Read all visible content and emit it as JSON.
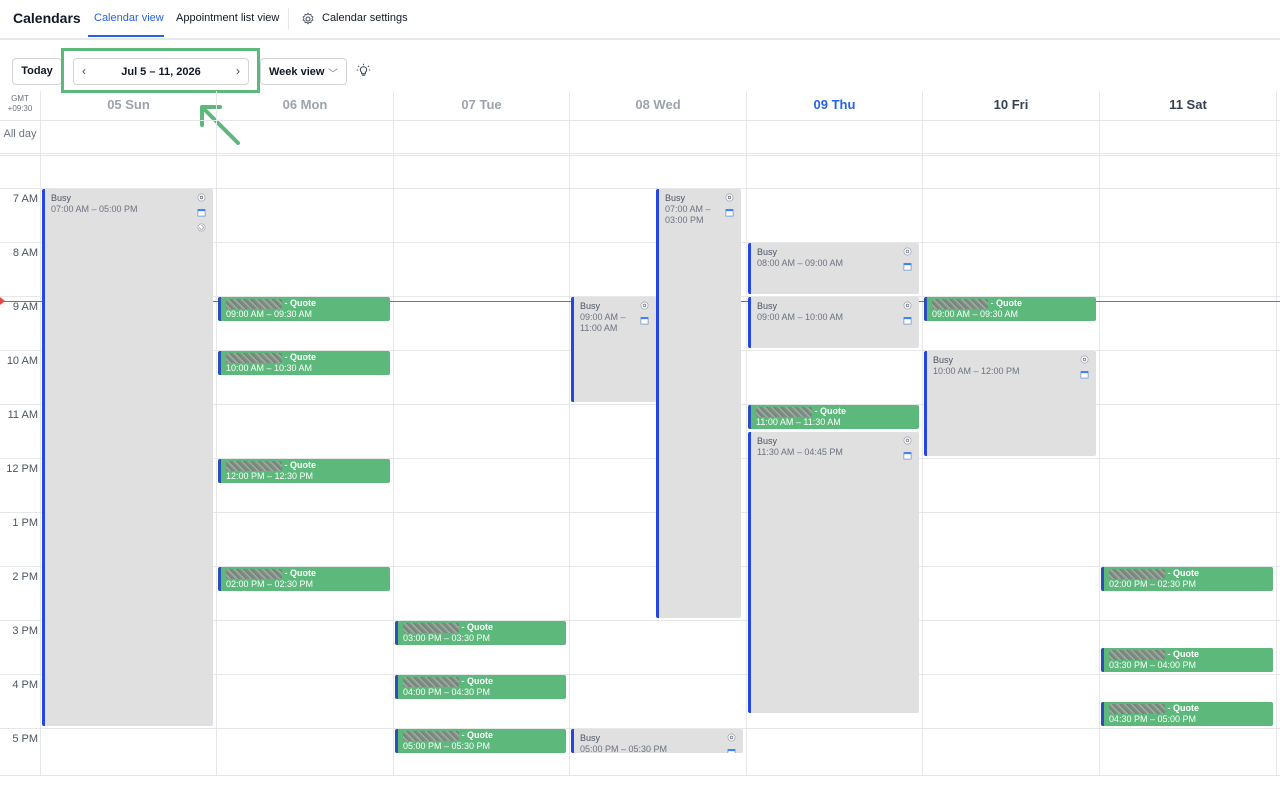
{
  "header": {
    "title": "Calendars",
    "tabs": [
      {
        "label": "Calendar view",
        "active": true
      },
      {
        "label": "Appointment list view",
        "active": false
      }
    ],
    "settings_label": "Calendar settings"
  },
  "toolbar": {
    "today_label": "Today",
    "date_range": "Jul 5 – 11, 2026",
    "view_select": "Week view"
  },
  "grid": {
    "timezone_line1": "GMT",
    "timezone_line2": "+09:30",
    "all_day_label": "All day",
    "days": [
      {
        "label": "05 Sun",
        "state": "past"
      },
      {
        "label": "06 Mon",
        "state": "past"
      },
      {
        "label": "07 Tue",
        "state": "past"
      },
      {
        "label": "08 Wed",
        "state": "past"
      },
      {
        "label": "09 Thu",
        "state": "today"
      },
      {
        "label": "10 Fri",
        "state": "future"
      },
      {
        "label": "11 Sat",
        "state": "future"
      }
    ],
    "hours": [
      "7 AM",
      "8 AM",
      "9 AM",
      "10 AM",
      "11 AM",
      "12 PM",
      "1 PM",
      "2 PM",
      "3 PM",
      "4 PM",
      "5 PM"
    ]
  },
  "events": [
    {
      "day": 0,
      "type": "busy",
      "title": "Busy",
      "time": "07:00 AM – 05:00 PM",
      "start": 7.0,
      "end": 17.0
    },
    {
      "day": 1,
      "type": "quote",
      "title": "- Quote",
      "time": "09:00 AM – 09:30 AM",
      "start": 9.0,
      "end": 9.5
    },
    {
      "day": 1,
      "type": "quote",
      "title": "- Quote",
      "time": "10:00 AM – 10:30 AM",
      "start": 10.0,
      "end": 10.5
    },
    {
      "day": 1,
      "type": "quote",
      "title": "- Quote",
      "time": "12:00 PM – 12:30 PM",
      "start": 12.0,
      "end": 12.5
    },
    {
      "day": 1,
      "type": "quote",
      "title": "- Quote",
      "time": "02:00 PM – 02:30 PM",
      "start": 14.0,
      "end": 14.5
    },
    {
      "day": 2,
      "type": "quote",
      "title": "- Quote",
      "time": "03:00 PM – 03:30 PM",
      "start": 15.0,
      "end": 15.5
    },
    {
      "day": 2,
      "type": "quote",
      "title": "- Quote",
      "time": "04:00 PM – 04:30 PM",
      "start": 16.0,
      "end": 16.5
    },
    {
      "day": 2,
      "type": "quote",
      "title": "- Quote",
      "time": "05:00 PM – 05:30 PM",
      "start": 17.0,
      "end": 17.5
    },
    {
      "day": 3,
      "type": "busy",
      "title": "Busy",
      "time": "09:00 AM – 11:00 AM",
      "start": 9.0,
      "end": 11.0,
      "slot": "left"
    },
    {
      "day": 3,
      "type": "busy",
      "title": "Busy",
      "time": "07:00 AM – 03:00 PM",
      "start": 7.0,
      "end": 15.0,
      "slot": "right"
    },
    {
      "day": 3,
      "type": "busy",
      "title": "Busy",
      "time": "05:00 PM – 05:30 PM",
      "start": 17.0,
      "end": 17.5
    },
    {
      "day": 4,
      "type": "busy",
      "title": "Busy",
      "time": "08:00 AM – 09:00 AM",
      "start": 8.0,
      "end": 9.0
    },
    {
      "day": 4,
      "type": "busy",
      "title": "Busy",
      "time": "09:00 AM – 10:00 AM",
      "start": 9.0,
      "end": 10.0
    },
    {
      "day": 4,
      "type": "quote",
      "title": "- Quote",
      "time": "11:00 AM – 11:30 AM",
      "start": 11.0,
      "end": 11.5
    },
    {
      "day": 4,
      "type": "busy",
      "title": "Busy",
      "time": "11:30 AM – 04:45 PM",
      "start": 11.5,
      "end": 16.75
    },
    {
      "day": 5,
      "type": "quote",
      "title": "- Quote",
      "time": "09:00 AM – 09:30 AM",
      "start": 9.0,
      "end": 9.5
    },
    {
      "day": 5,
      "type": "busy",
      "title": "Busy",
      "time": "10:00 AM – 12:00 PM",
      "start": 10.0,
      "end": 12.0
    },
    {
      "day": 6,
      "type": "quote",
      "title": "- Quote",
      "time": "02:00 PM – 02:30 PM",
      "start": 14.0,
      "end": 14.5
    },
    {
      "day": 6,
      "type": "quote",
      "title": "- Quote",
      "time": "03:30 PM – 04:00 PM",
      "start": 15.5,
      "end": 16.0
    },
    {
      "day": 6,
      "type": "quote",
      "title": "- Quote",
      "time": "04:30 PM – 05:00 PM",
      "start": 16.5,
      "end": 17.0
    }
  ],
  "current_time_hour": 9.1,
  "colors": {
    "accent": "#2563eb",
    "quote": "#5cb87b",
    "busy": "#e0e0e0",
    "now_line": "#ef4444"
  }
}
